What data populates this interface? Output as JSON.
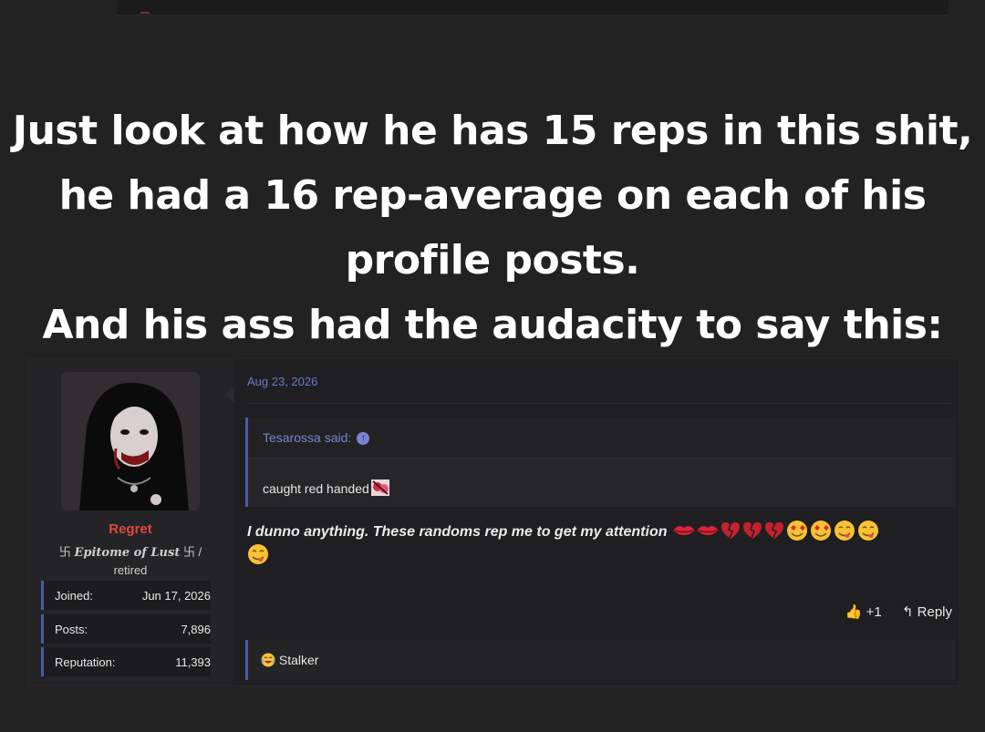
{
  "caption": {
    "lines": [
      "Just look at how he has 15 reps in this shit,",
      "he had a 16 rep-average on each of his",
      "profile posts.",
      "And his ass had the audacity to say this:"
    ]
  },
  "user": {
    "name": "Regret",
    "title_prefix": "卐 ",
    "title_fancy": "Epitome of Lust",
    "title_suffix": " 卐 /",
    "title_line2": "retired",
    "stats": [
      {
        "label": "Joined:",
        "value": "Jun 17, 2026"
      },
      {
        "label": "Posts:",
        "value": "7,896"
      },
      {
        "label": "Reputation:",
        "value": "11,393"
      }
    ]
  },
  "post": {
    "date": "Aug 23, 2026",
    "quote_author": "Tesarossa said:",
    "quote_text": "caught red handed",
    "message": "I dunno anything. These randoms rep me to get my attention",
    "rep_count": "+1",
    "reply_label": "Reply",
    "reaction_label": "Stalker"
  },
  "colors": {
    "background": "#222223",
    "username": "#e0483e",
    "accent": "#4a5aa8",
    "link": "#7585cf"
  }
}
